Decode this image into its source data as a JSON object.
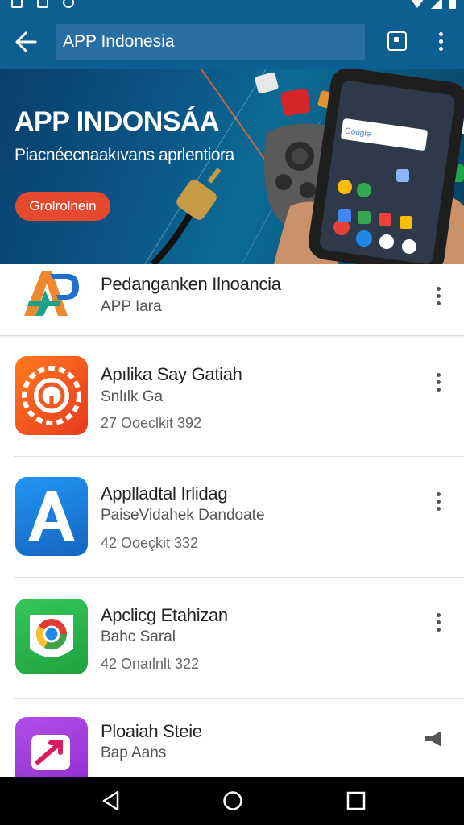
{
  "search": {
    "value": "APP Indonesia"
  },
  "banner": {
    "title": "APP INDONSÁA",
    "subtitle": "Piacnéecnaakıvans aprlentiora",
    "button_label": "Grolrolnein"
  },
  "featured": {
    "title": "Pedanganken Ilnoancia",
    "subtitle": "APP Iara"
  },
  "apps": [
    {
      "title": "Apılika Say Gatiah",
      "developer": "Snlılk Ga",
      "meta": "27 Ooeclkit 392",
      "icon": "gear-spiral-icon",
      "color": "#f4511e"
    },
    {
      "title": "Applladtal Irlidag",
      "developer": "PaiseVidahek Dandoate",
      "meta": "42 Ooeçkit 332",
      "icon": "letter-a-icon",
      "color": "#1e88e5"
    },
    {
      "title": "Apclicg Etahizan",
      "developer": "Bahc Saral",
      "meta": "42 Onaılnlt 322",
      "icon": "chrome-ring-icon",
      "color": "#2db84c"
    },
    {
      "title": "Ploaiah Steie",
      "developer": "Bap Aans",
      "meta": "",
      "icon": "arrow-icon",
      "color": "#a335d6"
    }
  ]
}
